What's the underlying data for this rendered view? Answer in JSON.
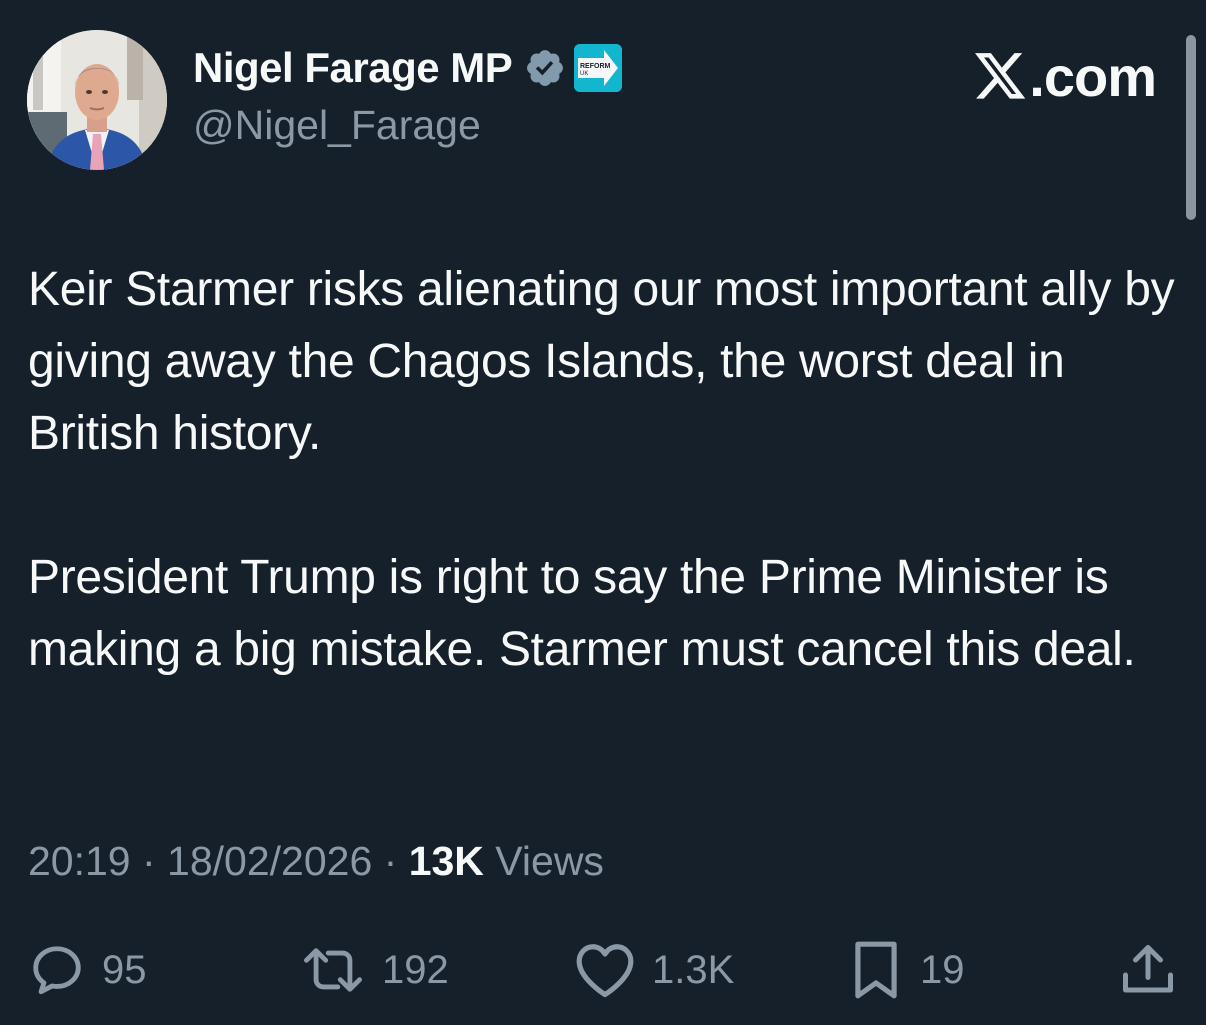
{
  "post": {
    "author": {
      "display_name": "Nigel Farage MP",
      "handle": "@Nigel_Farage",
      "badges": [
        "verified-badge-icon",
        "reform-uk-affiliation-badge"
      ],
      "affiliation_label_line1": "REFORM",
      "affiliation_label_line2": "UK"
    },
    "source": {
      "brand": "X",
      "domain": ".com"
    },
    "text": {
      "paragraph_1": "Keir Starmer risks alienating our most important ally by giving away the Chagos Islands, the worst deal in British history.",
      "paragraph_2": "President Trump is right to say the Prime Minister is making a big mistake. Starmer must cancel this deal."
    },
    "meta": {
      "time": "20:19",
      "separator": " · ",
      "date": "18/02/2026",
      "views_count": "13K",
      "views_label": " Views"
    },
    "actions": {
      "replies": "95",
      "reposts": "192",
      "likes": "1.3K",
      "bookmarks": "19"
    }
  },
  "colors": {
    "background": "#15202b",
    "primary_text": "#f7f9f9",
    "secondary_text": "#8b98a5",
    "verified_badge": "#829aab",
    "affiliation_badge": "#12b6cf"
  }
}
